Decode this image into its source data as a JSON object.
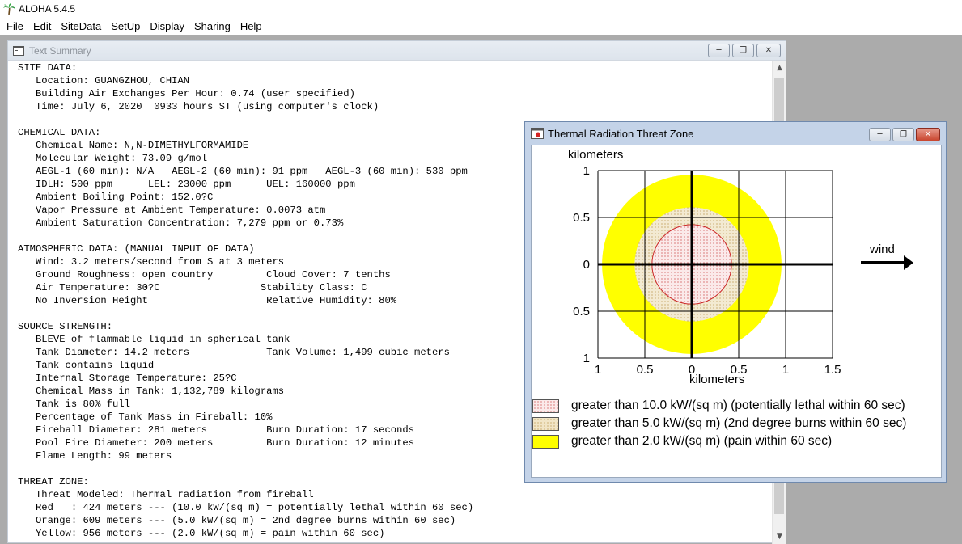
{
  "app": {
    "title": "ALOHA 5.4.5"
  },
  "menubar": {
    "items": [
      "File",
      "Edit",
      "SiteData",
      "SetUp",
      "Display",
      "Sharing",
      "Help"
    ]
  },
  "text_summary": {
    "title": "Text Summary",
    "lines": [
      "SITE DATA:",
      "   Location: GUANGZHOU, CHIAN",
      "   Building Air Exchanges Per Hour: 0.74 (user specified)",
      "   Time: July 6, 2020  0933 hours ST (using computer's clock)",
      "",
      "CHEMICAL DATA:",
      "   Chemical Name: N,N-DIMETHYLFORMAMIDE",
      "   Molecular Weight: 73.09 g/mol",
      "   AEGL-1 (60 min): N/A   AEGL-2 (60 min): 91 ppm   AEGL-3 (60 min): 530 ppm",
      "   IDLH: 500 ppm      LEL: 23000 ppm      UEL: 160000 ppm",
      "   Ambient Boiling Point: 152.0?C",
      "   Vapor Pressure at Ambient Temperature: 0.0073 atm",
      "   Ambient Saturation Concentration: 7,279 ppm or 0.73%",
      "",
      "ATMOSPHERIC DATA: (MANUAL INPUT OF DATA)",
      "   Wind: 3.2 meters/second from S at 3 meters",
      "   Ground Roughness: open country         Cloud Cover: 7 tenths",
      "   Air Temperature: 30?C                 Stability Class: C",
      "   No Inversion Height                    Relative Humidity: 80%",
      "",
      "SOURCE STRENGTH:",
      "   BLEVE of flammable liquid in spherical tank",
      "   Tank Diameter: 14.2 meters             Tank Volume: 1,499 cubic meters",
      "   Tank contains liquid",
      "   Internal Storage Temperature: 25?C",
      "   Chemical Mass in Tank: 1,132,789 kilograms",
      "   Tank is 80% full",
      "   Percentage of Tank Mass in Fireball: 10%",
      "   Fireball Diameter: 281 meters          Burn Duration: 17 seconds",
      "   Pool Fire Diameter: 200 meters         Burn Duration: 12 minutes",
      "   Flame Length: 99 meters",
      "",
      "THREAT ZONE:",
      "   Threat Modeled: Thermal radiation from fireball",
      "   Red   : 424 meters --- (10.0 kW/(sq m) = potentially lethal within 60 sec)",
      "   Orange: 609 meters --- (5.0 kW/(sq m) = 2nd degree burns within 60 sec)",
      "   Yellow: 956 meters --- (2.0 kW/(sq m) = pain within 60 sec)"
    ]
  },
  "threat_zone": {
    "title": "Thermal Radiation Threat Zone",
    "y_axis_label": "kilometers",
    "x_axis_label": "kilometers",
    "y_ticks": [
      "1",
      "0.5",
      "0",
      "0.5",
      "1"
    ],
    "x_ticks": [
      "1",
      "0.5",
      "0",
      "0.5",
      "1",
      "1.5"
    ],
    "wind_label": "wind",
    "zones_km": {
      "red": 0.424,
      "orange": 0.609,
      "yellow": 0.956
    },
    "colors": {
      "red_zone_fill": "#fbe9e9",
      "red_zone_stroke": "#cc2a2a",
      "orange_zone_fill": "#efe6cf",
      "yellow_zone_fill": "#ffff00"
    },
    "legend": [
      {
        "label": "greater than 10.0 kW/(sq m) (potentially lethal within 60 sec)",
        "color": "#f5dada"
      },
      {
        "label": "greater than 5.0 kW/(sq m) (2nd degree burns within 60 sec)",
        "color": "#efe3c3"
      },
      {
        "label": "greater than 2.0 kW/(sq m) (pain within 60 sec)",
        "color": "#ffff00"
      }
    ]
  }
}
